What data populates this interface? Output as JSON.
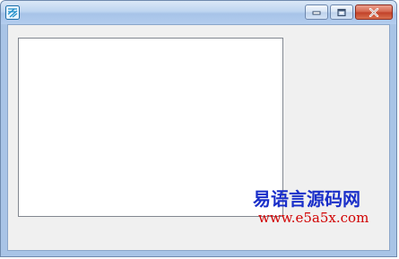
{
  "window": {
    "title": "",
    "icons": {
      "app": "app-icon",
      "minimize": "minimize-icon",
      "maximize": "maximize-icon",
      "close": "close-icon"
    }
  },
  "colors": {
    "title_bar": "#bed5f0",
    "client_bg": "#f0f0f0",
    "close_button": "#c2432a",
    "watermark_title": "#1a2fc9",
    "watermark_url": "#d10000"
  },
  "watermark": {
    "title": "易语言源码网",
    "url": "www.e5a5x.com"
  }
}
